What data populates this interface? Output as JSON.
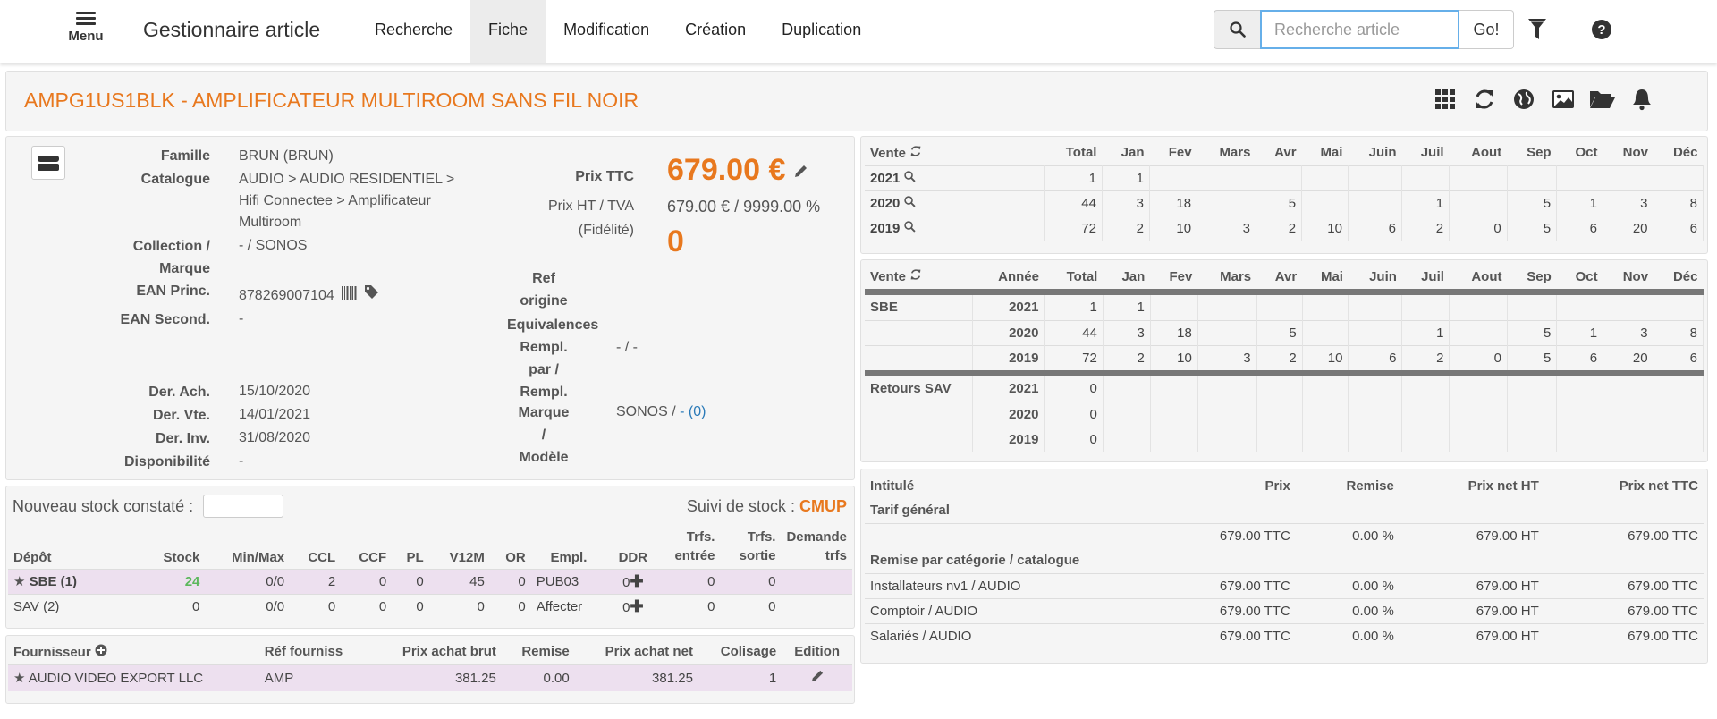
{
  "nav": {
    "menu_label": "Menu",
    "brand": "Gestionnaire article",
    "links": [
      "Recherche",
      "Fiche",
      "Modification",
      "Création",
      "Duplication"
    ],
    "active": "Fiche",
    "search_placeholder": "Recherche article",
    "go_label": "Go!",
    "icons": [
      "search-icon",
      "filter-icon",
      "help-icon"
    ]
  },
  "title": "AMPG1US1BLK - AMPLIFICATEUR MULTIROOM SANS FIL NOIR",
  "title_icons": [
    "grid-icon",
    "refresh-icon",
    "globe-icon",
    "image-icon",
    "folder-open-icon",
    "bell-icon"
  ],
  "info": {
    "famille_label": "Famille",
    "famille": "BRUN (BRUN)",
    "catalogue_label": "Catalogue",
    "catalogue_lines": [
      "AUDIO > AUDIO RESIDENTIEL >",
      "Hifi Connectee > Amplificateur",
      "Multiroom"
    ],
    "collection_label_lines": [
      "Collection /",
      "Marque"
    ],
    "collection": "- / SONOS",
    "ean_princ_label": "EAN Princ.",
    "ean_princ": "878269007104",
    "ean_second_label": "EAN Second.",
    "ean_second": "-",
    "der_ach_label": "Der. Ach.",
    "der_ach": "15/10/2020",
    "der_vte_label": "Der. Vte.",
    "der_vte": "14/01/2021",
    "der_inv_label": "Der. Inv.",
    "der_inv": "31/08/2020",
    "dispo_label": "Disponibilité",
    "dispo": "-",
    "prix_ttc_label": "Prix TTC",
    "prix_ttc": "679.00 €",
    "prix_ht_label_lines": [
      "Prix HT / TVA",
      "(Fidélité)"
    ],
    "prix_ht": "679.00 € / 9999.00 %",
    "fidelite": "0",
    "ref_origine_lines": [
      "Ref",
      "origine"
    ],
    "equivalences_label": "Equivalences",
    "rempl_label_lines": [
      "Rempl.",
      "par /",
      "Rempl."
    ],
    "rempl": "- / -",
    "marque_label_lines": [
      "Marque",
      "/",
      "Modèle"
    ],
    "marque_val": "SONOS / ",
    "marque_link": "- (0)"
  },
  "stock": {
    "nouveau_label": "Nouveau stock constaté :",
    "suivi_label": "Suivi de stock :",
    "suivi_value": "CMUP",
    "headers": [
      "Dépôt",
      "Stock",
      "Min/Max",
      "CCL",
      "CCF",
      "PL",
      "V12M",
      "OR",
      "Empl.",
      "DDR",
      "Trfs. entrée",
      "Trfs. sortie",
      "Demande trfs"
    ],
    "rows": [
      {
        "depot": "SBE (1)",
        "stock": "24",
        "minmax": "0/0",
        "ccl": "2",
        "ccf": "0",
        "pl": "0",
        "v12m": "45",
        "or": "0",
        "empl": "PUB03",
        "ddr": "0",
        "trfs_entree": "0",
        "trfs_sortie": "0",
        "demande": ""
      },
      {
        "depot": "SAV (2)",
        "stock": "0",
        "minmax": "0/0",
        "ccl": "0",
        "ccf": "0",
        "pl": "0",
        "v12m": "0",
        "or": "0",
        "empl": "Affecter",
        "ddr": "0",
        "trfs_entree": "0",
        "trfs_sortie": "0",
        "demande": ""
      }
    ],
    "colors": {
      "stock_positive": "#5cb85c",
      "highlight": "#ede0ef"
    }
  },
  "fournisseur": {
    "headers": [
      "Fournisseur",
      "Réf fourniss",
      "Prix achat brut",
      "Remise",
      "Prix achat net",
      "Colisage",
      "Edition"
    ],
    "rows": [
      {
        "name": "AUDIO VIDEO EXPORT LLC",
        "ref": "AMP",
        "brut": "381.25",
        "remise": "0.00",
        "net": "381.25",
        "colisage": "1"
      }
    ]
  },
  "ventes1": {
    "headers": [
      "Vente",
      "Total",
      "Jan",
      "Fev",
      "Mars",
      "Avr",
      "Mai",
      "Juin",
      "Juil",
      "Aout",
      "Sep",
      "Oct",
      "Nov",
      "Déc"
    ],
    "rows": [
      {
        "year": "2021",
        "vals": [
          "1",
          "1",
          "",
          "",
          "",
          "",
          "",
          "",
          "",
          "",
          "",
          "",
          ""
        ]
      },
      {
        "year": "2020",
        "vals": [
          "44",
          "3",
          "18",
          "",
          "5",
          "",
          "",
          "1",
          "",
          "5",
          "1",
          "3",
          "8"
        ]
      },
      {
        "year": "2019",
        "vals": [
          "72",
          "2",
          "10",
          "3",
          "2",
          "10",
          "6",
          "2",
          "0",
          "5",
          "6",
          "20",
          "6"
        ]
      }
    ]
  },
  "ventes2": {
    "headers": [
      "Vente",
      "Année",
      "Total",
      "Jan",
      "Fev",
      "Mars",
      "Avr",
      "Mai",
      "Juin",
      "Juil",
      "Aout",
      "Sep",
      "Oct",
      "Nov",
      "Déc"
    ],
    "groups": [
      {
        "name": "SBE",
        "rows": [
          {
            "year": "2021",
            "vals": [
              "1",
              "1",
              "",
              "",
              "",
              "",
              "",
              "",
              "",
              "",
              "",
              "",
              ""
            ]
          },
          {
            "year": "2020",
            "vals": [
              "44",
              "3",
              "18",
              "",
              "5",
              "",
              "",
              "1",
              "",
              "5",
              "1",
              "3",
              "8"
            ]
          },
          {
            "year": "2019",
            "vals": [
              "72",
              "2",
              "10",
              "3",
              "2",
              "10",
              "6",
              "2",
              "0",
              "5",
              "6",
              "20",
              "6"
            ]
          }
        ]
      },
      {
        "name": "Retours SAV",
        "rows": [
          {
            "year": "2021",
            "vals": [
              "0",
              "",
              "",
              "",
              "",
              "",
              "",
              "",
              "",
              "",
              "",
              "",
              ""
            ]
          },
          {
            "year": "2020",
            "vals": [
              "0",
              "",
              "",
              "",
              "",
              "",
              "",
              "",
              "",
              "",
              "",
              "",
              ""
            ]
          },
          {
            "year": "2019",
            "vals": [
              "0",
              "",
              "",
              "",
              "",
              "",
              "",
              "",
              "",
              "",
              "",
              "",
              ""
            ]
          }
        ]
      }
    ]
  },
  "tarifs": {
    "headers": [
      "Intitulé",
      "Prix",
      "Remise",
      "Prix net HT",
      "Prix net TTC"
    ],
    "section1": "Tarif général",
    "general": {
      "prix": "679.00 TTC",
      "remise": "0.00 %",
      "net_ht": "679.00 HT",
      "net_ttc": "679.00 TTC"
    },
    "section2": "Remise par catégorie / catalogue",
    "rows": [
      {
        "label": "Installateurs nv1 / AUDIO",
        "prix": "679.00 TTC",
        "remise": "0.00 %",
        "net_ht": "679.00 HT",
        "net_ttc": "679.00 TTC"
      },
      {
        "label": "Comptoir / AUDIO",
        "prix": "679.00 TTC",
        "remise": "0.00 %",
        "net_ht": "679.00 HT",
        "net_ttc": "679.00 TTC"
      },
      {
        "label": "Salariés / AUDIO",
        "prix": "679.00 TTC",
        "remise": "0.00 %",
        "net_ht": "679.00 HT",
        "net_ttc": "679.00 TTC"
      }
    ]
  },
  "colors": {
    "accent": "#e8781e",
    "link": "#2a7ab8",
    "focus": "#66afe9"
  }
}
